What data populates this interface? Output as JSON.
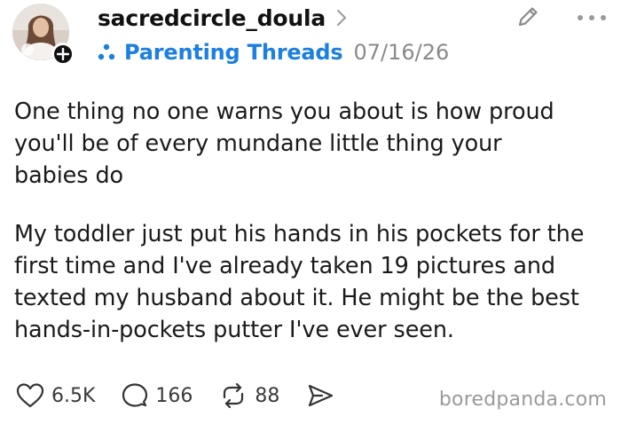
{
  "post": {
    "username": "sacredcircle_doula",
    "community": "Parenting Threads",
    "date": "07/16/26",
    "paragraphs": [
      "One thing no one warns you about is how proud\nyou'll be of every mundane little thing your\nbabies do",
      "My toddler just put his hands in his pockets for the\nfirst time and I've already taken 19 pictures and\ntexted my husband about it. He might be the best\nhands-in-pockets putter I've ever seen."
    ],
    "likes": "6.5K",
    "replies": "166",
    "reposts": "88"
  },
  "watermark": "boredpanda.com",
  "icons": {
    "avatar": "avatar-photo",
    "follow": "plus-icon",
    "community": "community-dots-icon",
    "edit": "pencil-icon",
    "more": "more-dots-icon",
    "like": "heart-icon",
    "reply": "comment-icon",
    "repost": "repost-icon",
    "share": "share-icon"
  },
  "colors": {
    "accent": "#1d7fe0",
    "text": "#1a1a1a",
    "muted": "#8a8a8a"
  }
}
